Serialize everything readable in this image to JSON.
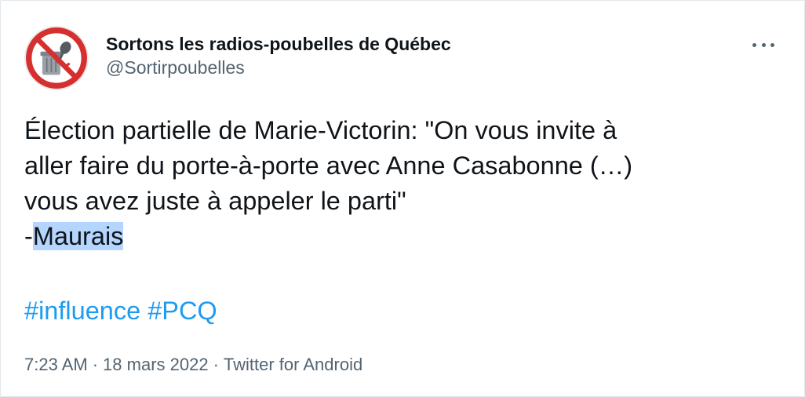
{
  "account": {
    "display_name": "Sortons les radios-poubelles de Québec",
    "handle": "@Sortirpoubelles",
    "avatar_icon": "no-radio-trash-icon",
    "avatar_colors": {
      "ring": "#d62f2f",
      "background": "#ffffff"
    }
  },
  "menu": {
    "icon": "more-options-icon"
  },
  "tweet": {
    "lines": [
      "Élection partielle de Marie-Victorin: \"On vous invite à",
      "aller faire du porte-à-porte avec Anne Casabonne (…)",
      "vous avez juste à appeler le parti\""
    ],
    "attribution_prefix": "-",
    "attribution_name": "Maurais",
    "hashtags": [
      "#influence",
      "#PCQ"
    ]
  },
  "meta": {
    "time": "7:23 AM",
    "separator": "·",
    "date": "18 mars 2022",
    "source": "Twitter for Android"
  },
  "colors": {
    "text": "#0f1419",
    "secondary": "#536471",
    "link": "#1d9bf0",
    "selection": "#b4d5fe"
  }
}
